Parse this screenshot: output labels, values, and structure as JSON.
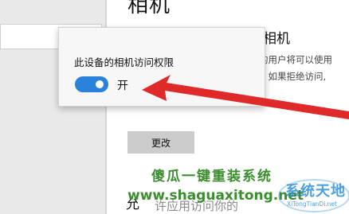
{
  "page": {
    "title": "相机",
    "section_title": "相机",
    "description_lines": [
      "的用户将可以使用",
      "。如果拒绝访问,",
      ""
    ],
    "change_button": "更改",
    "allow_label": "允",
    "allow_sub": "许应用访问你的"
  },
  "popup": {
    "title": "此设备的相机访问权限",
    "toggle_state_label": "开",
    "toggle_on": true
  },
  "watermark": {
    "text": "傻瓜一键重装系统",
    "url": "www.shaguaxitong.net",
    "brand": "系统天地",
    "brand_en": "XiTongTianDi.net"
  },
  "colors": {
    "accent": "#2a82da",
    "arrow": "#e02a2a",
    "watermark_green": "#3b8d2e"
  }
}
